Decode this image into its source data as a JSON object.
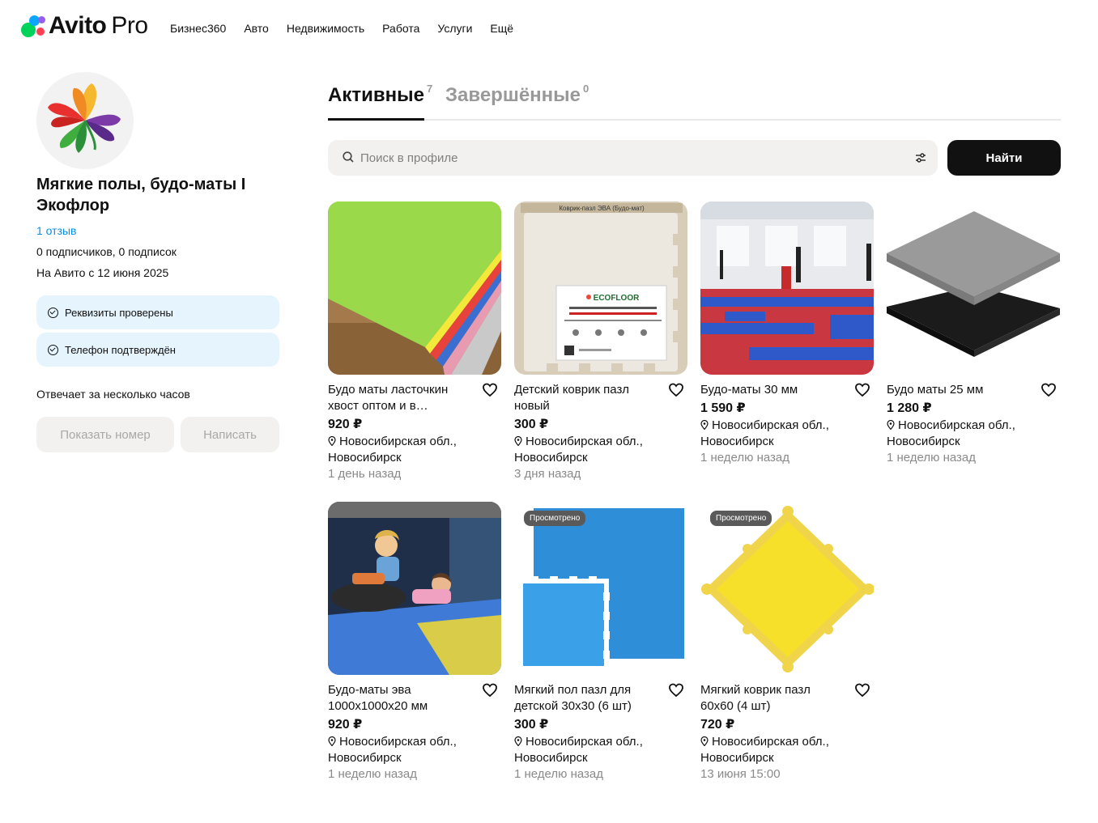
{
  "header": {
    "logo_brand": "Avito",
    "logo_suffix": "Pro",
    "nav": [
      "Бизнес360",
      "Авто",
      "Недвижимость",
      "Работа",
      "Услуги",
      "Ещё"
    ]
  },
  "profile": {
    "name": "Мягкие полы, будо-маты I Экофлор",
    "reviews": "1 отзыв",
    "subscribers": "0 подписчиков, 0 подписок",
    "since": "На Авито с 12 июня 2025",
    "verifications": [
      "Реквизиты проверены",
      "Телефон подтверждён"
    ],
    "response_time": "Отвечает за несколько часов",
    "show_phone": "Показать номер",
    "write": "Написать"
  },
  "tabs": {
    "active_label": "Активные",
    "active_count": "7",
    "done_label": "Завершённые",
    "done_count": "0"
  },
  "search": {
    "placeholder": "Поиск в профиле",
    "button": "Найти"
  },
  "listings": [
    {
      "title": "Будо маты ласточкин хвост оптом и в…",
      "price": "920 ₽",
      "location": "Новосибирская обл., Новосибирск",
      "date": "1 день назад",
      "badge": ""
    },
    {
      "title": "Детский коврик пазл новый",
      "price": "300 ₽",
      "location": "Новосибирская обл., Новосибирск",
      "date": "3 дня назад",
      "badge": ""
    },
    {
      "title": "Будо-маты 30 мм",
      "price": "1 590 ₽",
      "location": "Новосибирская обл., Новосибирск",
      "date": "1 неделю назад",
      "badge": ""
    },
    {
      "title": "Будо маты 25 мм",
      "price": "1 280 ₽",
      "location": "Новосибирская обл., Новосибирск",
      "date": "1 неделю назад",
      "badge": ""
    },
    {
      "title": "Будо-маты эва 1000х1000х20 мм",
      "price": "920 ₽",
      "location": "Новосибирская обл., Новосибирск",
      "date": "1 неделю назад",
      "badge": ""
    },
    {
      "title": "Мягкий пол пазл для детской 30х30 (6 шт)",
      "price": "300 ₽",
      "location": "Новосибирская обл., Новосибирск",
      "date": "1 неделю назад",
      "badge": "Просмотрено"
    },
    {
      "title": "Мягкий коврик пазл 60х60 (4 шт)",
      "price": "720 ₽",
      "location": "Новосибирская обл., Новосибирск",
      "date": "13 июня 15:00",
      "badge": "Просмотрено"
    }
  ],
  "image_texts": {
    "box_label": "Коврик-пазл ЭВА (Будо-мат)",
    "ecofloor": "ECOFLOOR"
  },
  "colors": {
    "accent_blue": "#0a8fdc",
    "verify_bg": "#e5f4fd",
    "button_dark": "#111111"
  }
}
